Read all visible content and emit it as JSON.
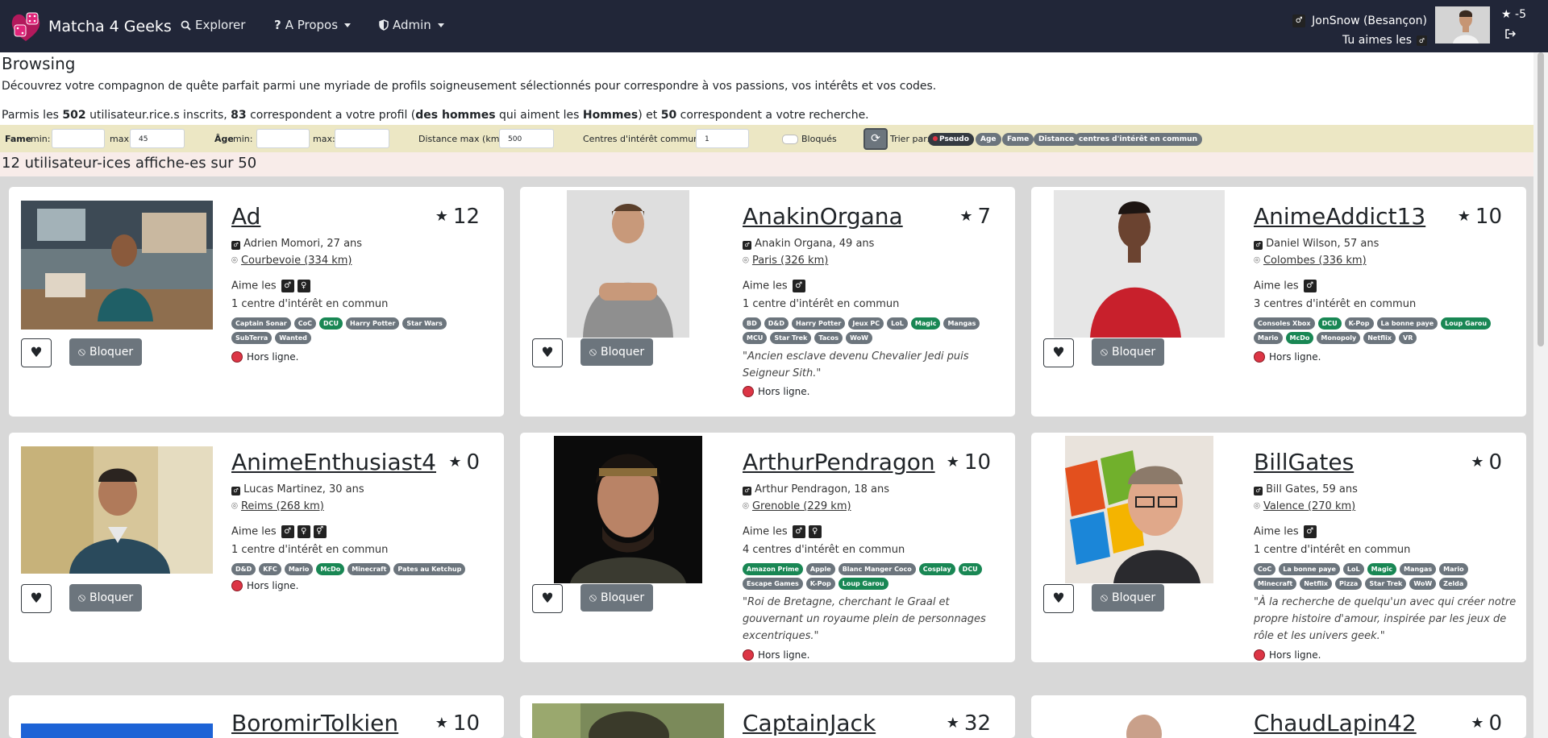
{
  "nav": {
    "brand": "Matcha 4 Geeks",
    "explore": "Explorer",
    "about": "A Propos",
    "admin": "Admin",
    "user_label": "JonSnow (Besançon)",
    "likes_label": "Tu aimes les",
    "fame": "-5"
  },
  "page": {
    "title": "Browsing",
    "description": "Découvrez votre compagnon de quête parfait parmi une myriade de profils soigneusement sélectionnés pour correspondre à vos passions, vos intérêts et vos codes.",
    "stats": {
      "p1": "Parmis les ",
      "total": "502",
      "p2": " utilisateur.rice.s inscrits, ",
      "match": "83",
      "p3": " correspondent a votre profil (",
      "men": "des hommes",
      "p4": " qui aiment les ",
      "hommes": "Hommes",
      "p5": ") et ",
      "search": "50",
      "p6": " correspondent a votre recherche."
    }
  },
  "filters": {
    "fame_label": "Fame",
    "min_label": "min:",
    "max_label": "max:",
    "fame_max": "45",
    "age_label": "Âge",
    "age_min_label": "min:",
    "age_max_label": "max:",
    "distance_label": "Distance max (km):",
    "distance": "500",
    "common_label": "Centres d'intérêt commun:",
    "common": "1",
    "blocked_label": "Bloqués",
    "sort_label": "Trier par:",
    "sort_options": [
      "Pseudo",
      "Age",
      "Fame",
      "Distance",
      "centres d'intérêt en commun"
    ]
  },
  "results": {
    "title": "12 utilisateur-ices affiche-es sur 50"
  },
  "buttons": {
    "block": "Bloquer"
  },
  "likes_word": "Aime les",
  "offline": "Hors ligne.",
  "cards": [
    {
      "name": "Ad",
      "fame": "12",
      "info": "Adrien Momori, 27 ans",
      "city": "Courbevoie (334 km)",
      "common": "1 centre d'intérêt en commun",
      "tags": [
        [
          "Captain Sonar",
          0
        ],
        [
          "CoC",
          0
        ],
        [
          "DCU",
          1
        ],
        [
          "Harry Potter",
          0
        ],
        [
          "Star Wars",
          0
        ],
        [
          "SubTerra",
          0
        ],
        [
          "Wanted",
          0
        ]
      ],
      "quote": ""
    },
    {
      "name": "AnakinOrgana",
      "fame": "7",
      "info": "Anakin Organa, 49 ans",
      "city": "Paris (326 km)",
      "common": "1 centre d'intérêt en commun",
      "tags": [
        [
          "BD",
          0
        ],
        [
          "D&D",
          0
        ],
        [
          "Harry Potter",
          0
        ],
        [
          "Jeux PC",
          0
        ],
        [
          "LoL",
          0
        ],
        [
          "Magic",
          1
        ],
        [
          "Mangas",
          0
        ],
        [
          "MCU",
          0
        ],
        [
          "Star Trek",
          0
        ],
        [
          "Tacos",
          0
        ],
        [
          "WoW",
          0
        ]
      ],
      "quote": "\"Ancien esclave devenu Chevalier Jedi puis Seigneur Sith.\""
    },
    {
      "name": "AnimeAddict13",
      "fame": "10",
      "info": "Daniel Wilson, 57 ans",
      "city": "Colombes (336 km)",
      "common": "3 centres d'intérêt en commun",
      "tags": [
        [
          "Consoles Xbox",
          0
        ],
        [
          "DCU",
          1
        ],
        [
          "K-Pop",
          0
        ],
        [
          "La bonne paye",
          0
        ],
        [
          "Loup Garou",
          1
        ],
        [
          "Mario",
          0
        ],
        [
          "McDo",
          1
        ],
        [
          "Monopoly",
          0
        ],
        [
          "Netflix",
          0
        ],
        [
          "VR",
          0
        ]
      ],
      "quote": ""
    },
    {
      "name": "AnimeEnthusiast4",
      "fame": "0",
      "info": "Lucas Martinez, 30 ans",
      "city": "Reims (268 km)",
      "common": "1 centre d'intérêt en commun",
      "tags": [
        [
          "D&D",
          0
        ],
        [
          "KFC",
          0
        ],
        [
          "Mario",
          0
        ],
        [
          "McDo",
          1
        ],
        [
          "Minecraft",
          0
        ],
        [
          "Pates au Ketchup",
          0
        ]
      ],
      "quote": ""
    },
    {
      "name": "ArthurPendragon",
      "fame": "10",
      "info": "Arthur Pendragon, 18 ans",
      "city": "Grenoble (229 km)",
      "common": "4 centres d'intérêt en commun",
      "tags": [
        [
          "Amazon Prime",
          1
        ],
        [
          "Apple",
          0
        ],
        [
          "Blanc Manger Coco",
          0
        ],
        [
          "Cosplay",
          1
        ],
        [
          "DCU",
          1
        ],
        [
          "Escape Games",
          0
        ],
        [
          "K-Pop",
          0
        ],
        [
          "Loup Garou",
          1
        ]
      ],
      "quote": "\"Roi de Bretagne, cherchant le Graal et gouvernant un royaume plein de personnages excentriques.\""
    },
    {
      "name": "BillGates",
      "fame": "0",
      "info": "Bill Gates, 59 ans",
      "city": "Valence (270 km)",
      "common": "1 centre d'intérêt en commun",
      "tags": [
        [
          "CoC",
          0
        ],
        [
          "La bonne paye",
          0
        ],
        [
          "LoL",
          0
        ],
        [
          "Magic",
          1
        ],
        [
          "Mangas",
          0
        ],
        [
          "Mario",
          0
        ],
        [
          "Minecraft",
          0
        ],
        [
          "Netflix",
          0
        ],
        [
          "Pizza",
          0
        ],
        [
          "Star Trek",
          0
        ],
        [
          "WoW",
          0
        ],
        [
          "Zelda",
          0
        ]
      ],
      "quote": "\"À la recherche de quelqu'un avec qui créer notre propre histoire d'amour, inspirée par les jeux de rôle et les univers geek.\""
    },
    {
      "name": "BoromirTolkien",
      "fame": "10"
    },
    {
      "name": "CaptainJack",
      "fame": "32"
    },
    {
      "name": "ChaudLapin42",
      "fame": "0"
    }
  ]
}
